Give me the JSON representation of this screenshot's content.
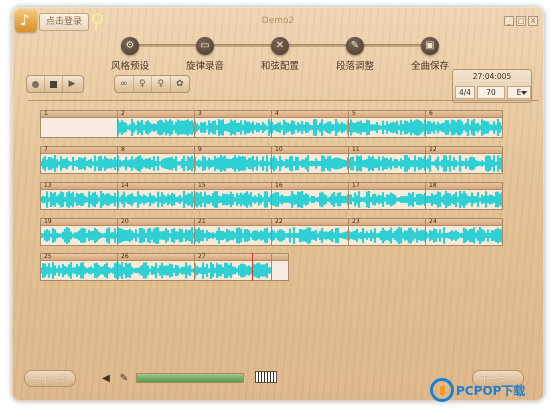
{
  "window": {
    "title": "Demo2",
    "login_label": "点击登录",
    "controls": [
      "_",
      "□",
      "X"
    ]
  },
  "steps": [
    {
      "label": "风格预设",
      "icon": "gear-icon",
      "glyph": "⚙"
    },
    {
      "label": "旋律录音",
      "icon": "folder-icon",
      "glyph": "▭"
    },
    {
      "label": "和弦配置",
      "icon": "tools-icon",
      "glyph": "✕"
    },
    {
      "label": "段落调整",
      "icon": "edit-icon",
      "glyph": "✎"
    },
    {
      "label": "全曲保存",
      "icon": "save-icon",
      "glyph": "▣"
    }
  ],
  "transport": {
    "record": "record-icon",
    "stop": "stop-icon",
    "play": "play-icon",
    "play_glyph": "▶"
  },
  "tools": [
    {
      "icon": "link-icon",
      "glyph": "∞"
    },
    {
      "icon": "bulb-icon",
      "glyph": "♀"
    },
    {
      "icon": "bulb2-icon",
      "glyph": "♀"
    },
    {
      "icon": "palette-icon",
      "glyph": "✿"
    }
  ],
  "info": {
    "time": "27:04:005",
    "meter": "4/4",
    "tempo": "70",
    "key": "E"
  },
  "measures": [
    [
      "1",
      "2",
      "3",
      "4",
      "5",
      "6"
    ],
    [
      "7",
      "8",
      "9",
      "10",
      "11",
      "12"
    ],
    [
      "13",
      "14",
      "15",
      "16",
      "17",
      "18"
    ],
    [
      "19",
      "20",
      "21",
      "22",
      "23",
      "24"
    ],
    [
      "25",
      "26",
      "27"
    ]
  ],
  "empty_measures": [
    "1"
  ],
  "wave_color": "#2fd0d4",
  "bottom": {
    "prev_label": "上一步",
    "next_label": "下一步",
    "volume_icon": "speaker-icon",
    "volume_glyph": "◀",
    "tool_icon": "wrench-icon",
    "tool_glyph": "✎",
    "progress_fraction": 1.0
  },
  "watermark": {
    "text": "PCPOP下载",
    "sub": "WWW.PCPOP.COM"
  }
}
